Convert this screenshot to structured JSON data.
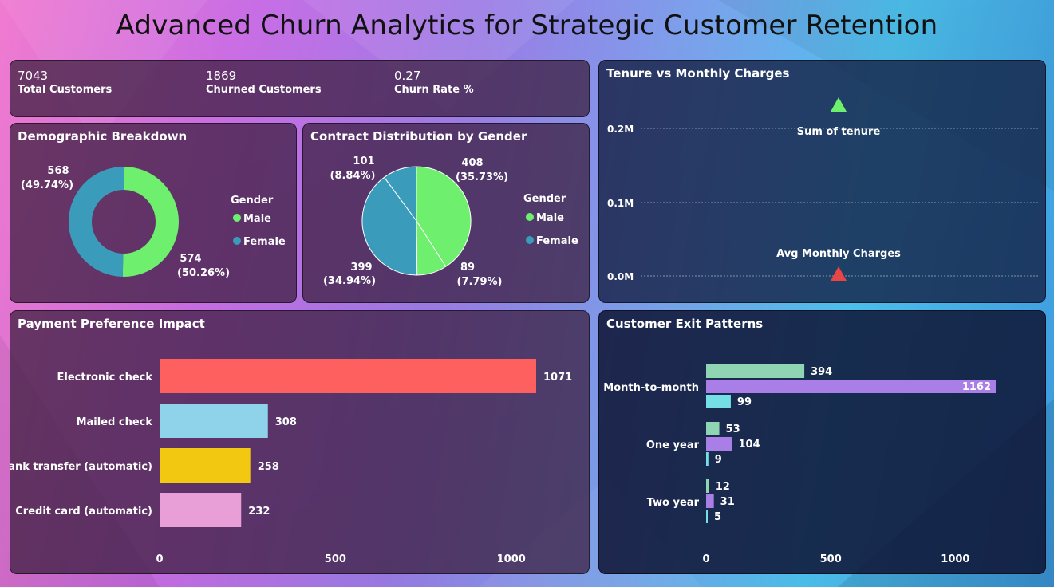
{
  "page": {
    "title": "Advanced Churn Analytics for Strategic Customer Retention"
  },
  "kpis": [
    {
      "value": "7043",
      "label": "Total Customers"
    },
    {
      "value": "1869",
      "label": "Churned Customers"
    },
    {
      "value": "0.27",
      "label": "Churn Rate %"
    }
  ],
  "legend": {
    "title": "Gender",
    "male": "Male",
    "female": "Female"
  },
  "colors": {
    "male": "#6ef06e",
    "female": "#3a9bba",
    "electronic_check": "#fe6060",
    "mailed_check": "#8fd3ea",
    "bank_transfer": "#f2c811",
    "credit_card": "#e89fd8",
    "exit_a": "#8fd4b3",
    "exit_b": "#a97ee6",
    "exit_c": "#74dfe6",
    "tri_up": "#6ef06e",
    "tri_down": "#e84545"
  },
  "chart_data": [
    {
      "id": "demographic",
      "type": "pie",
      "title": "Demographic Breakdown",
      "donut": true,
      "slices": [
        {
          "label": "Male",
          "value": 574,
          "pct": "(50.26%)"
        },
        {
          "label": "Female",
          "value": 568,
          "pct": "(49.74%)"
        }
      ],
      "legend_title": "Gender"
    },
    {
      "id": "contract",
      "type": "pie",
      "title": "Contract Distribution by Gender",
      "slices": [
        {
          "label": "Male",
          "value": 408,
          "pct": "(35.73%)"
        },
        {
          "label": "Male",
          "value": 89,
          "pct": "(7.79%)"
        },
        {
          "label": "Female",
          "value": 399,
          "pct": "(34.94%)"
        },
        {
          "label": "Female",
          "value": 101,
          "pct": "(8.84%)"
        }
      ],
      "legend_title": "Gender"
    },
    {
      "id": "tenure",
      "type": "scatter",
      "title": "Tenure vs Monthly Charges",
      "y_ticks": [
        "0.2M",
        "0.1M",
        "0.0M"
      ],
      "ylim": [
        0,
        200000
      ],
      "points": [
        {
          "label": "Sum of tenure",
          "y": 228174,
          "marker": "triangle-up"
        },
        {
          "label": "Avg Monthly Charges",
          "y": 65,
          "marker": "triangle-down"
        }
      ]
    },
    {
      "id": "payment",
      "type": "bar",
      "orientation": "horizontal",
      "title": "Payment Preference Impact",
      "categories": [
        "Electronic check",
        "Mailed check",
        "Bank transfer (automatic)",
        "Credit card (automatic)"
      ],
      "values": [
        1071,
        308,
        258,
        232
      ],
      "x_ticks": [
        0,
        500,
        1000
      ],
      "xlim": [
        0,
        1100
      ]
    },
    {
      "id": "exit",
      "type": "bar",
      "orientation": "horizontal",
      "title": "Customer Exit Patterns",
      "categories": [
        "Month-to-month",
        "One year",
        "Two year"
      ],
      "series": [
        {
          "values": [
            394,
            53,
            12
          ]
        },
        {
          "values": [
            1162,
            104,
            31
          ]
        },
        {
          "values": [
            99,
            9,
            5
          ]
        }
      ],
      "x_ticks": [
        0,
        500,
        1000
      ],
      "xlim": [
        0,
        1300
      ]
    }
  ]
}
